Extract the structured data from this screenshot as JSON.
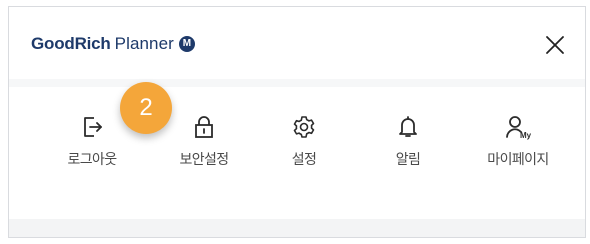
{
  "header": {
    "logo_bold": "GoodRich",
    "logo_light": "Planner",
    "logo_badge": "M"
  },
  "menu": {
    "items": [
      {
        "label": "로그아웃",
        "icon": "logout-icon"
      },
      {
        "label": "보안설정",
        "icon": "lock-icon"
      },
      {
        "label": "설정",
        "icon": "gear-icon"
      },
      {
        "label": "알림",
        "icon": "bell-icon"
      },
      {
        "label": "마이페이지",
        "icon": "my-page-icon",
        "icon_text": "My"
      }
    ]
  },
  "step_badge": "2",
  "colors": {
    "brand": "#1e3a6a",
    "badge": "#f4a63a",
    "label": "#4a4a4a",
    "icon": "#2b2b2b"
  }
}
